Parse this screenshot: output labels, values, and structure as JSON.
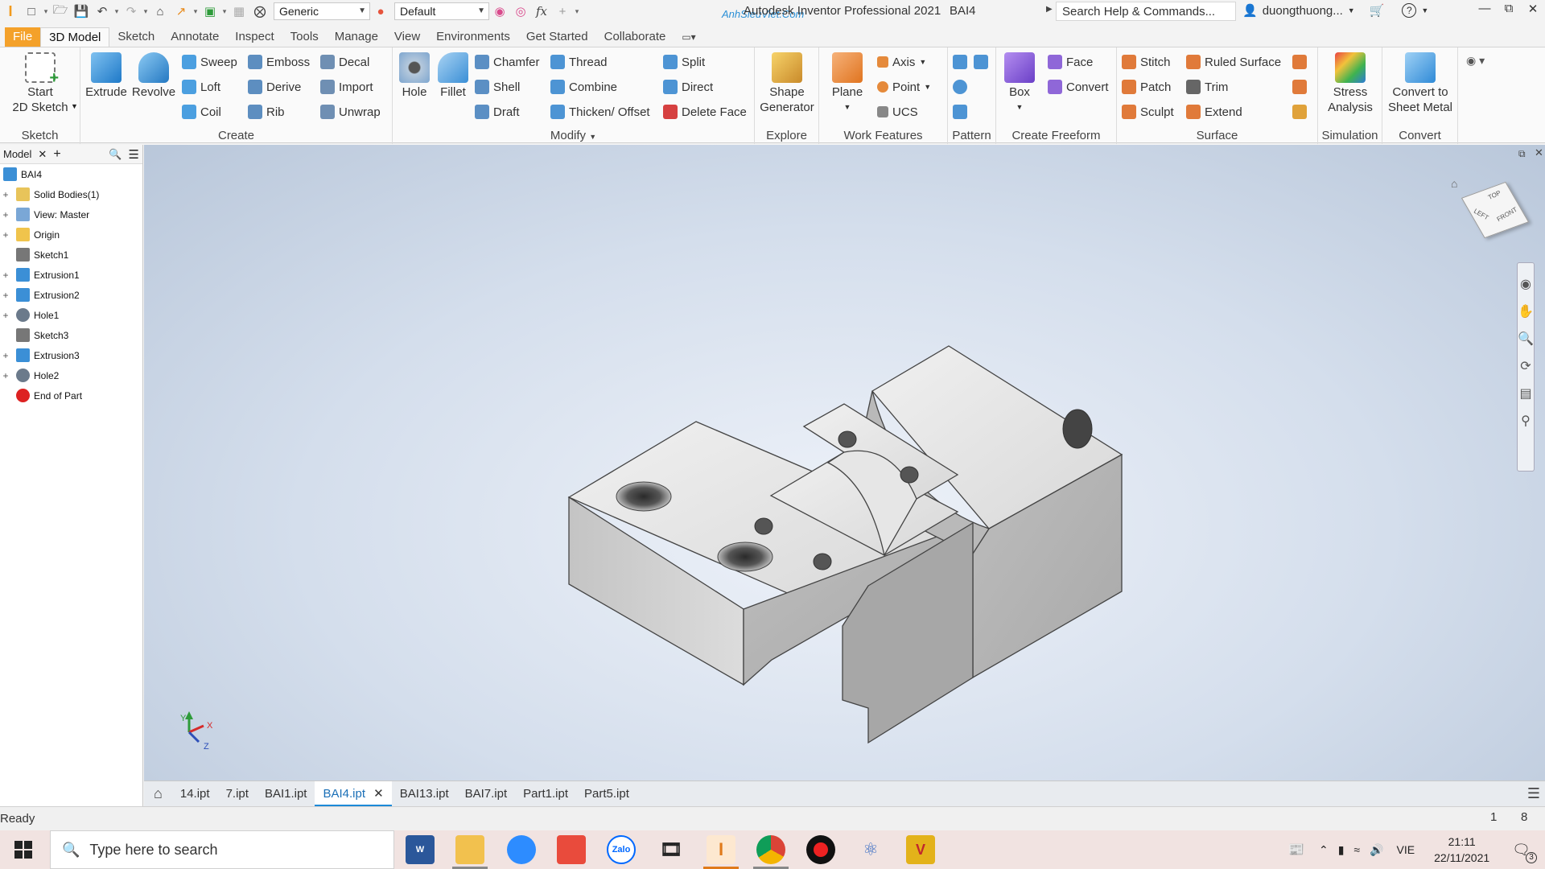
{
  "app": {
    "title": "Autodesk Inventor Professional 2021",
    "document": "BAI4",
    "watermark": "AnhSieuViet.Com"
  },
  "quick_access": {
    "material_value": "Generic",
    "appearance_value": "Default",
    "fx_label": "fx"
  },
  "search_help": {
    "placeholder": "Search Help & Commands..."
  },
  "user": {
    "name": "duongthuong..."
  },
  "ribbon_tabs": [
    "File",
    "3D Model",
    "Sketch",
    "Annotate",
    "Inspect",
    "Tools",
    "Manage",
    "View",
    "Environments",
    "Get Started",
    "Collaborate"
  ],
  "ribbon": {
    "sketch": {
      "label": "Sketch",
      "start_sketch": "Start\n2D Sketch"
    },
    "create": {
      "label": "Create",
      "extrude": "Extrude",
      "revolve": "Revolve",
      "sweep": "Sweep",
      "loft": "Loft",
      "coil": "Coil",
      "emboss": "Emboss",
      "derive": "Derive",
      "rib": "Rib",
      "decal": "Decal",
      "import": "Import",
      "unwrap": "Unwrap"
    },
    "modify": {
      "label": "Modify",
      "hole": "Hole",
      "fillet": "Fillet",
      "chamfer": "Chamfer",
      "shell": "Shell",
      "draft": "Draft",
      "thread": "Thread",
      "combine": "Combine",
      "thicken": "Thicken/ Offset",
      "split": "Split",
      "direct": "Direct",
      "delete_face": "Delete Face"
    },
    "explore": {
      "label": "Explore",
      "shape_generator": "Shape\nGenerator"
    },
    "work_features": {
      "label": "Work Features",
      "plane": "Plane",
      "axis": "Axis",
      "point": "Point",
      "ucs": "UCS"
    },
    "pattern": {
      "label": "Pattern"
    },
    "create_freeform": {
      "label": "Create Freeform",
      "box": "Box",
      "face": "Face",
      "convert": "Convert"
    },
    "surface": {
      "label": "Surface",
      "stitch": "Stitch",
      "patch": "Patch",
      "sculpt": "Sculpt",
      "ruled_surface": "Ruled Surface",
      "trim": "Trim",
      "extend": "Extend"
    },
    "simulation": {
      "label": "Simulation",
      "stress": "Stress\nAnalysis"
    },
    "convert": {
      "label": "Convert",
      "sheet_metal": "Convert to\nSheet Metal"
    }
  },
  "browser": {
    "tab_label": "Model",
    "root": "BAI4",
    "items": [
      {
        "label": "Solid Bodies(1)",
        "expandable": true,
        "icon": "folder-body-icon"
      },
      {
        "label": "View: Master",
        "expandable": true,
        "icon": "view-rep-icon"
      },
      {
        "label": "Origin",
        "expandable": true,
        "icon": "folder-icon"
      },
      {
        "label": "Sketch1",
        "expandable": false,
        "icon": "sketch-icon"
      },
      {
        "label": "Extrusion1",
        "expandable": true,
        "icon": "extrusion-icon"
      },
      {
        "label": "Extrusion2",
        "expandable": true,
        "icon": "extrusion-icon"
      },
      {
        "label": "Hole1",
        "expandable": true,
        "icon": "hole-icon"
      },
      {
        "label": "Sketch3",
        "expandable": false,
        "icon": "sketch-icon"
      },
      {
        "label": "Extrusion3",
        "expandable": true,
        "icon": "extrusion-icon"
      },
      {
        "label": "Hole2",
        "expandable": true,
        "icon": "hole-icon"
      },
      {
        "label": "End of Part",
        "expandable": false,
        "icon": "end-of-part-icon"
      }
    ]
  },
  "view_cube": {
    "top": "TOP",
    "front": "FRONT",
    "left": "LEFT"
  },
  "triad": {
    "x": "X",
    "y": "Y",
    "z": "Z"
  },
  "doc_tabs": [
    "14.ipt",
    "7.ipt",
    "BAI1.ipt",
    "BAI4.ipt",
    "BAI13.ipt",
    "BAI7.ipt",
    "Part1.ipt",
    "Part5.ipt"
  ],
  "doc_tabs_active": "BAI4.ipt",
  "status": {
    "text": "Ready",
    "count1": "1",
    "count2": "8"
  },
  "taskbar": {
    "search_placeholder": "Type here to search",
    "lang": "VIE",
    "time": "21:11",
    "date": "22/11/2021",
    "notifications": "3"
  },
  "colors": {
    "accent": "#1d8ad8",
    "file_tab": "#f4a12a",
    "viewport_bg": "#d4deec"
  }
}
